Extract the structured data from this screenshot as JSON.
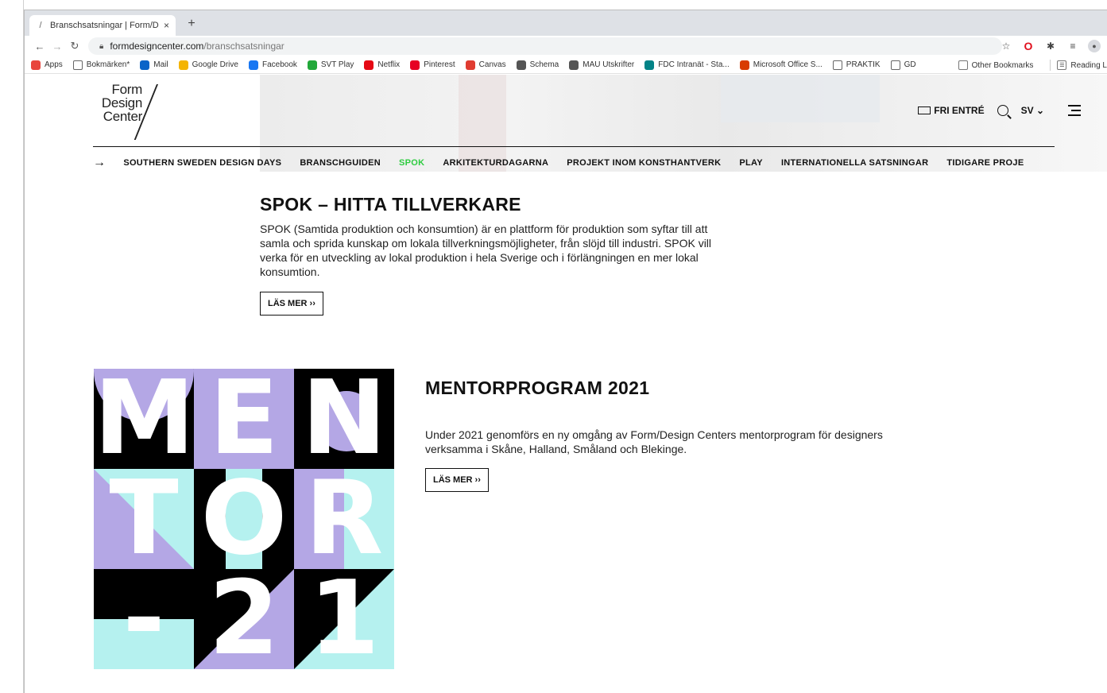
{
  "browser": {
    "tab_title": "Branschsatsningar | Form/Desi",
    "tab_close": "×",
    "new_tab": "+",
    "url_domain": "formdesigncenter.com",
    "url_path": "/branschsatsningar",
    "bookmarks": [
      {
        "label": "Apps",
        "icon": "apps-grid-icon",
        "color": "#e8453c"
      },
      {
        "label": "Bokmärken*",
        "icon": "folder-icon",
        "color": "#666666"
      },
      {
        "label": "Mail",
        "icon": "outlook-icon",
        "color": "#0a64c8"
      },
      {
        "label": "Google Drive",
        "icon": "google-drive-icon",
        "color": "#f4b400"
      },
      {
        "label": "Facebook",
        "icon": "facebook-icon",
        "color": "#1877f2"
      },
      {
        "label": "SVT Play",
        "icon": "play-icon",
        "color": "#22a83a"
      },
      {
        "label": "Netflix",
        "icon": "netflix-icon",
        "color": "#e50914"
      },
      {
        "label": "Pinterest",
        "icon": "pinterest-icon",
        "color": "#e60023"
      },
      {
        "label": "Canvas",
        "icon": "canvas-icon",
        "color": "#e03c31"
      },
      {
        "label": "Schema",
        "icon": "globe-icon",
        "color": "#555555"
      },
      {
        "label": "MAU Utskrifter",
        "icon": "globe-icon",
        "color": "#555555"
      },
      {
        "label": "FDC Intranät - Sta...",
        "icon": "sharepoint-icon",
        "color": "#038387"
      },
      {
        "label": "Microsoft Office S...",
        "icon": "office-icon",
        "color": "#d83b01"
      },
      {
        "label": "PRAKTIK",
        "icon": "folder-icon",
        "color": "#666666"
      },
      {
        "label": "GD",
        "icon": "folder-icon",
        "color": "#666666"
      }
    ],
    "other_bookmarks": "Other Bookmarks",
    "reading_list": "Reading L"
  },
  "site": {
    "logo": {
      "line1": "Form",
      "line2": "Design",
      "line3": "Center"
    },
    "header": {
      "ticket_label": "FRI ENTRÉ",
      "lang": "SV"
    },
    "subnav_arrow": "→",
    "subnav": [
      {
        "label": "SOUTHERN SWEDEN DESIGN DAYS",
        "active": false
      },
      {
        "label": "BRANSCHGUIDEN",
        "active": false
      },
      {
        "label": "SPOK",
        "active": true
      },
      {
        "label": "ARKITEKTURDAGARNA",
        "active": false
      },
      {
        "label": "PROJEKT INOM KONSTHANTVERK",
        "active": false
      },
      {
        "label": "PLAY",
        "active": false
      },
      {
        "label": "INTERNATIONELLA SATSNINGAR",
        "active": false
      },
      {
        "label": "TIDIGARE PROJE",
        "active": false
      }
    ],
    "accent_color": "#2ecc40"
  },
  "spok": {
    "title": "SPOK – HITTA TILLVERKARE",
    "description": "SPOK (Samtida produktion och konsumtion) är en plattform för produktion som syftar till att samla och sprida kunskap om lokala tillverkningsmöjligheter, från slöjd till industri. SPOK vill verka för en utveckling av lokal produktion i hela Sverige och i förlängningen en mer lokal konsumtion.",
    "button": "LÄS MER ››"
  },
  "mentor": {
    "title": "MENTORPROGRAM 2021",
    "description": "Under 2021 genomförs en ny omgång av Form/Design Centers mentorprogram för designers verksamma i Skåne, Halland, Småland och Blekinge.",
    "button": "LÄS MER ››",
    "poster_letters": [
      "M",
      "E",
      "N",
      "T",
      "O",
      "R",
      "-",
      "2",
      "1"
    ],
    "poster_colors": {
      "black": "#000000",
      "lilac": "#b4a7e5",
      "aqua": "#b5f1ef",
      "white": "#ffffff"
    }
  }
}
